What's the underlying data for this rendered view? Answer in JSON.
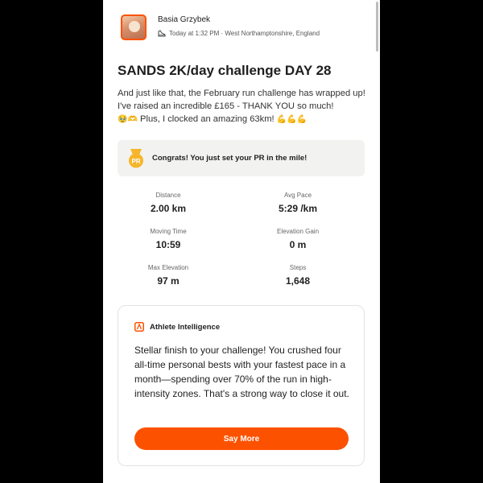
{
  "colors": {
    "accent": "#fc5200",
    "banner_bg": "#f2f2f0",
    "badge_yellow": "#f6b52a"
  },
  "activity": {
    "athlete_name": "Basia Grzybek",
    "time_location": "Today at 1:32 PM · West Northamptonshire, England",
    "sport_icon": "running-shoe-icon",
    "title": "SANDS 2K/day challenge DAY 28",
    "description_text": "And just like that, the February run challenge has wrapped up! I've raised an incredible £165 - THANK YOU so much!",
    "description_emoji_1": "🥹",
    "description_emoji_2": "🫶",
    "description_text_2": "Plus, I clocked an amazing 63km!",
    "description_emoji_3": "💪💪💪"
  },
  "pr_banner": {
    "badge_label": "PR",
    "text": "Congrats! You just set your PR in the mile!"
  },
  "stats": [
    {
      "label": "Distance",
      "value": "2.00 km"
    },
    {
      "label": "Avg Pace",
      "value": "5:29 /km"
    },
    {
      "label": "Moving Time",
      "value": "10:59"
    },
    {
      "label": "Elevation Gain",
      "value": "0 m"
    },
    {
      "label": "Max Elevation",
      "value": "97 m"
    },
    {
      "label": "Steps",
      "value": "1,648"
    }
  ],
  "athlete_intelligence": {
    "icon": "athlete-intelligence-icon",
    "title": "Athlete Intelligence",
    "body": "Stellar finish to your challenge! You crushed four all-time personal bests with your fastest pace in a month—spending over 70% of the run in high-intensity zones. That's a strong way to close it out.",
    "button_label": "Say More"
  }
}
